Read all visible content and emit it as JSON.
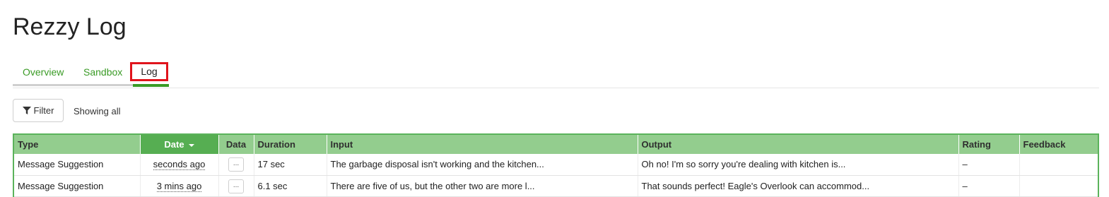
{
  "title": "Rezzy Log",
  "tabs": [
    {
      "label": "Overview"
    },
    {
      "label": "Sandbox"
    },
    {
      "label": "Log"
    }
  ],
  "toolbar": {
    "filter_label": "Filter",
    "status": "Showing all"
  },
  "table": {
    "columns": [
      "Type",
      "Date",
      "Data",
      "Duration",
      "Input",
      "Output",
      "Rating",
      "Feedback"
    ],
    "rows": [
      {
        "type": "Message Suggestion",
        "date": "seconds ago",
        "data": "...",
        "duration": "17 sec",
        "input": "The garbage disposal isn't working and the kitchen...",
        "output": "Oh no! I'm so sorry you're dealing with kitchen is...",
        "rating": "–",
        "feedback": ""
      },
      {
        "type": "Message Suggestion",
        "date": "3 mins ago",
        "data": "...",
        "duration": "6.1 sec",
        "input": "There are five of us, but the other two are more l...",
        "output": "That sounds perfect! Eagle's Overlook can accommod...",
        "rating": "–",
        "feedback": ""
      }
    ]
  },
  "colors": {
    "accent_green": "#3a9b26",
    "header_green": "#93cd8e",
    "sorted_header_green": "#56ae52",
    "highlight_red": "#e0141c"
  }
}
